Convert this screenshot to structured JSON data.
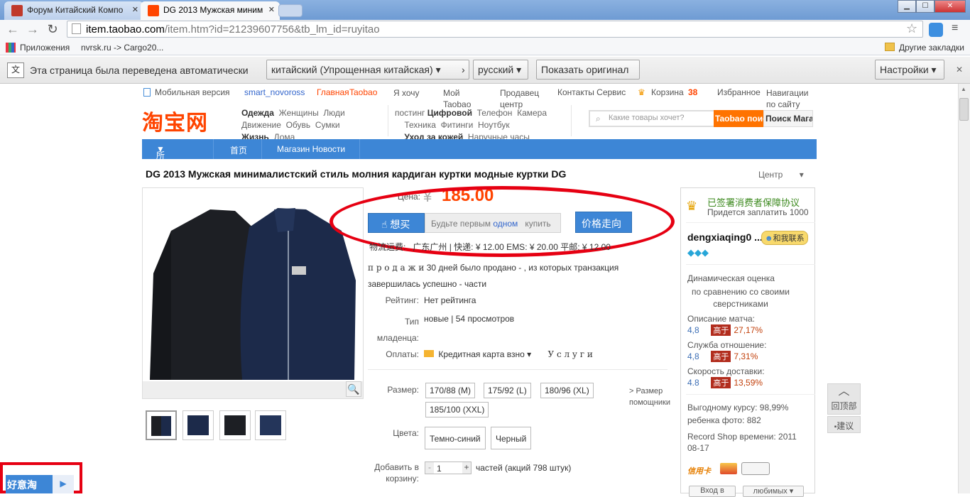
{
  "browser": {
    "tabs": [
      {
        "label": "Форум Китайский Компо",
        "active": false
      },
      {
        "label": "DG 2013 Мужская миним",
        "active": true
      }
    ],
    "url_host": "item.taobao.com",
    "url_rest": "/item.htm?id=21239607756&tb_lm_id=ruyitao",
    "bookmarks": [
      "Приложения",
      "nvrsk.ru -> Cargo20...",
      "Другие закладки"
    ],
    "translate": {
      "message": "Эта страница была переведена автоматически",
      "from_lang": "китайский (Упрощенная китайская)",
      "to_lang": "русский",
      "show_original": "Показать оригинал",
      "settings": "Настройки"
    }
  },
  "topnav": {
    "mobile": "Мобильная версия",
    "user": "smart_novoross",
    "main": "Главная",
    "taobao": "Taobao",
    "want": "Я хочу",
    "my_taobao": "Мой Taobao",
    "seller_center": "Продавец центр",
    "contacts": "Контакты Сервис",
    "cart": "Корзина",
    "cart_count": "38",
    "favorites": "Избранное",
    "navigation": "Навигации по сайту"
  },
  "header": {
    "logo": "淘宝网",
    "cat1": {
      "title": "Одежда",
      "items": [
        "Женщины",
        "Люди",
        "Движение",
        "Обувь",
        "Сумки"
      ],
      "title2": "Жизнь",
      "item2": "Дома"
    },
    "cat2": {
      "lead": "постинг",
      "title": "Цифровой",
      "items": [
        "Телефон",
        "Камера",
        "Техника",
        "Фитинги",
        "Ноутбук"
      ],
      "title2": "Уход за кожей",
      "item2": "Наручные часы"
    },
    "search_placeholder": "Какие товары хочет?",
    "search_btn": "Taobao поиск",
    "search_btn2": "Поиск Магазин"
  },
  "bluebar": {
    "all_categories": "所有分类",
    "home": "首页",
    "shop_news": "Магазин Новости"
  },
  "product": {
    "title": "DG 2013 Мужская минималистский стиль молния кардиган куртки модные куртки DG",
    "centr": "Центр",
    "price_label": "Цена:",
    "currency": "¥",
    "price": "185.00",
    "want_btn": "想买",
    "want_text_1": "Будьте первым",
    "want_text_link": "одном",
    "want_text_2": "купить",
    "price_btn": "价格走向",
    "shipping_label": "物流运费:",
    "shipping": "广东广州 | 快递: ¥ 12.00  EMS: ¥ 20.00  平邮: ¥ 12.00",
    "sold_prefix": "п р о д а ж и",
    "sold_text": "30  дней было продано - , из которых транзакция",
    "sold_text2": "завершилась успешно - части",
    "rating_label": "Рейтинг:",
    "rating": "Нет рейтинга",
    "type_label": "Тип младенца:",
    "type_value": "новые  |  54 просмотров",
    "payment_label": "Оплаты:",
    "payment": "Кредитная карта взно",
    "services": "У с л у г и",
    "size_label": "Размер:",
    "sizes": [
      "170/88 (M)",
      "175/92 (L)",
      "180/96 (XL)",
      "185/100 (XXL)"
    ],
    "size_helper": "> Размер помощники",
    "color_label": "Цвета:",
    "colors": [
      "Темно-синий",
      "Черный"
    ],
    "qty_label": "Добавить в корзину:",
    "qty": "1",
    "qty_note": "частей (акций 798 штук)"
  },
  "seller": {
    "guarantee": "已签署消费者保障协议",
    "pay_note": "Придется заплатить  1000",
    "name": "dengxiaqing0 ...",
    "contact": "和我联系",
    "dynamic_title": "Динамическая оценка",
    "dynamic_sub": "по сравнению со своими сверстниками",
    "metrics": [
      {
        "label": "Описание матча:",
        "score": "4,8",
        "badge": "高于",
        "pct": "27,17%"
      },
      {
        "label": "Служба отношение:",
        "score": "4,8",
        "badge": "高于",
        "pct": "7,31%"
      },
      {
        "label": "Скорость доставки:",
        "score": "4.8",
        "badge": "高于",
        "pct": "13,59%"
      }
    ],
    "good_rate": "Выгодному курсу: 98,99%",
    "baby_photo": "ребенка фото: 882",
    "record": "Record Shop времени: 2011 08-17",
    "credit": "信用卡",
    "enter_btn": "Вход в",
    "fav_btn": "любимых"
  },
  "floating": {
    "back_top": "回顶部",
    "suggest": "建议",
    "hao": "好意淘"
  }
}
